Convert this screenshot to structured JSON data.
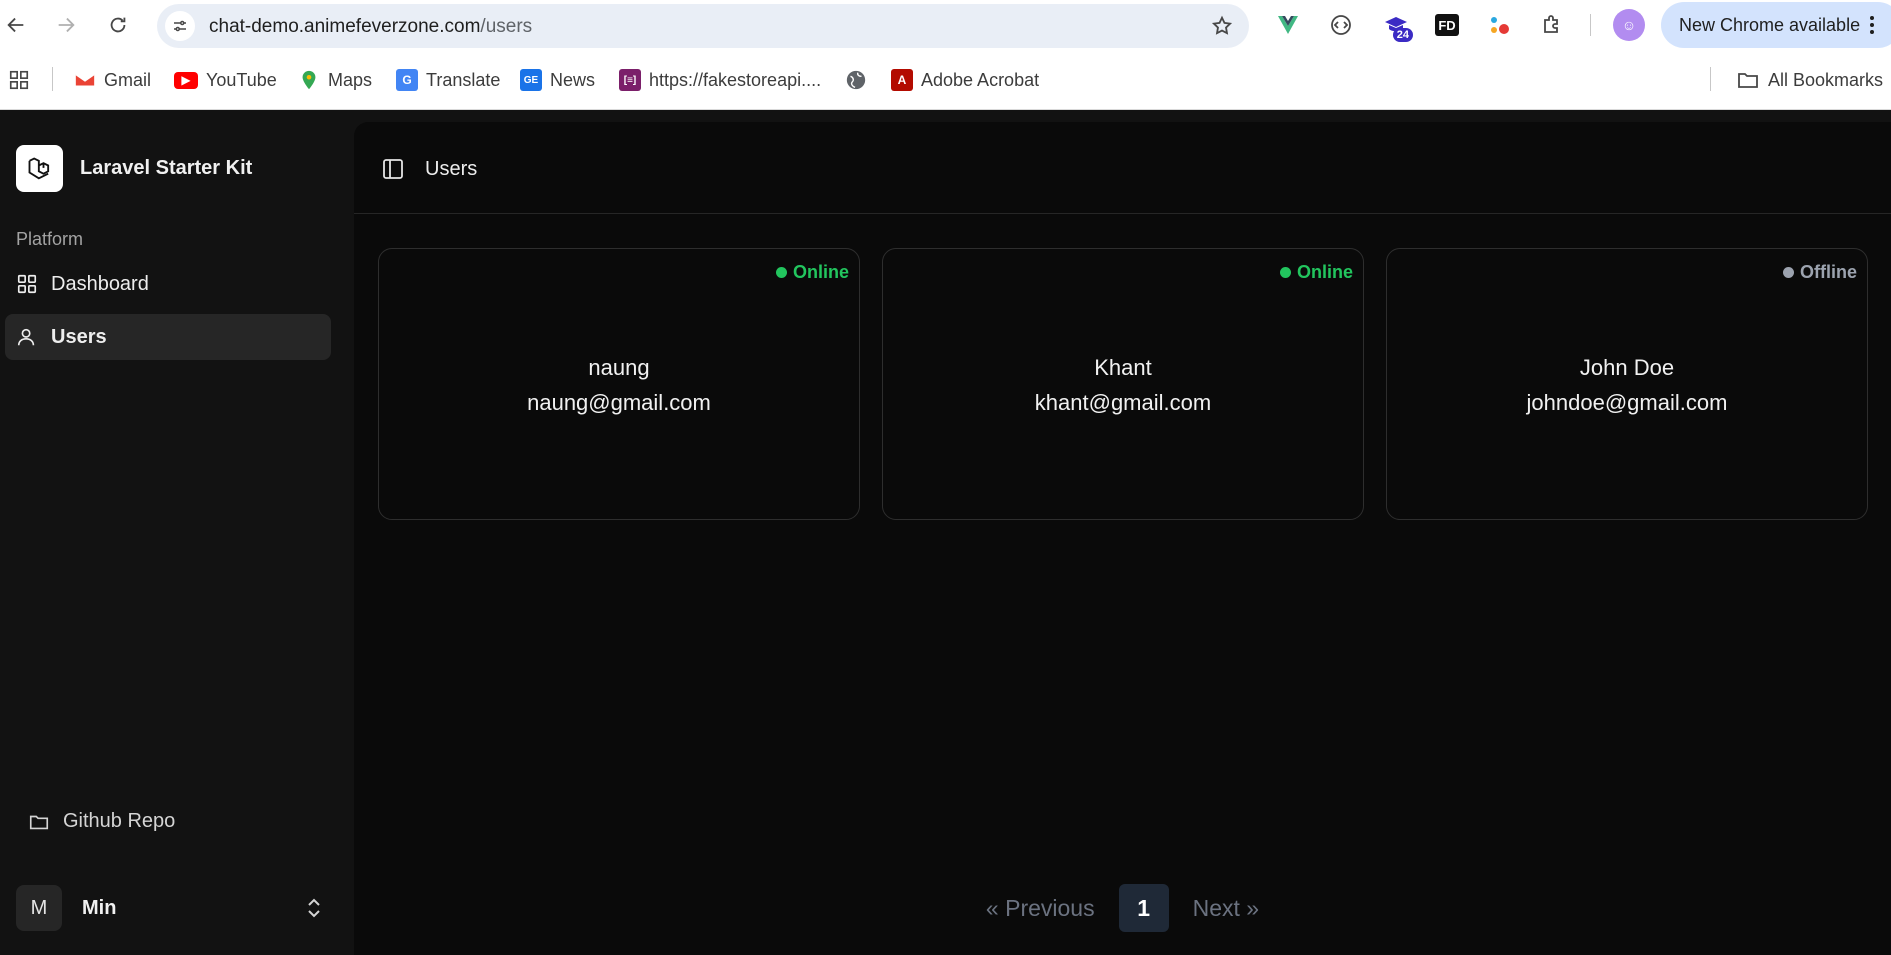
{
  "browser": {
    "url_host": "chat-demo.animefeverzone.com",
    "url_path": "/users",
    "extension_badge": "24",
    "extension_badge_small": "1",
    "profile_initial": "☺",
    "new_chrome_label": "New Chrome available"
  },
  "bookmarks": [
    {
      "label": "Gmail",
      "icon": "gmail-icon"
    },
    {
      "label": "YouTube",
      "icon": "youtube-icon"
    },
    {
      "label": "Maps",
      "icon": "maps-icon"
    },
    {
      "label": "Translate",
      "icon": "translate-icon"
    },
    {
      "label": "News",
      "icon": "news-icon"
    },
    {
      "label": "https://fakestoreapi....",
      "icon": "fakestore-icon"
    },
    {
      "label": "Adobe Acrobat",
      "icon": "acrobat-icon"
    }
  ],
  "all_bookmarks_label": "All Bookmarks",
  "sidebar": {
    "brand": "Laravel Starter Kit",
    "group_label": "Platform",
    "items": [
      {
        "label": "Dashboard",
        "icon": "dashboard-grid-icon",
        "active": false
      },
      {
        "label": "Users",
        "icon": "users-icon",
        "active": true
      }
    ],
    "footer_link": "Github Repo",
    "user": {
      "initial": "M",
      "name": "Min"
    }
  },
  "header": {
    "breadcrumb": "Users"
  },
  "users": [
    {
      "name": "naung",
      "email": "naung@gmail.com",
      "status": "Online",
      "status_color": "#22c55e"
    },
    {
      "name": "Khant",
      "email": "khant@gmail.com",
      "status": "Online",
      "status_color": "#22c55e"
    },
    {
      "name": "John Doe",
      "email": "johndoe@gmail.com",
      "status": "Offline",
      "status_color": "#9ca3af"
    }
  ],
  "pagination": {
    "previous": "« Previous",
    "current": "1",
    "next": "Next »"
  },
  "colors": {
    "sidebar_bg": "#121212",
    "main_bg": "#0a0a0a",
    "online": "#22c55e",
    "offline": "#9ca3af"
  }
}
